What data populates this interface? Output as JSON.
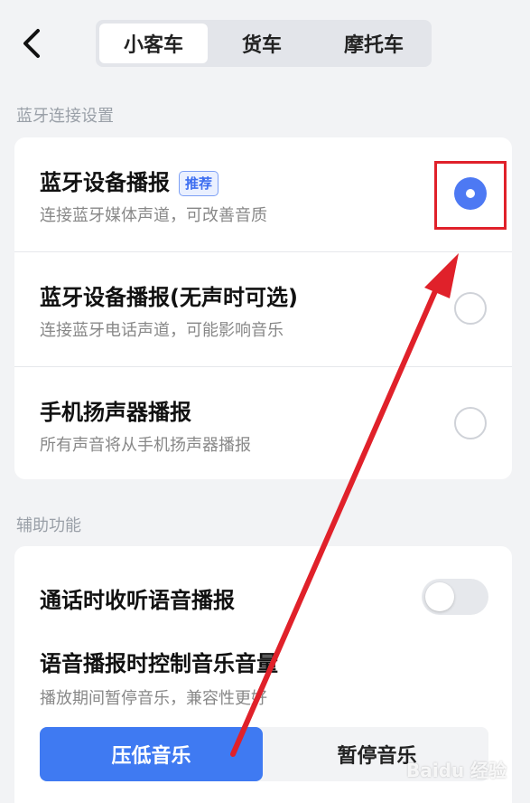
{
  "header": {
    "tabs": [
      {
        "label": "小客车",
        "active": true
      },
      {
        "label": "货车",
        "active": false
      },
      {
        "label": "摩托车",
        "active": false
      }
    ]
  },
  "bluetooth_section": {
    "title": "蓝牙连接设置",
    "options": [
      {
        "title": "蓝牙设备播报",
        "badge": "推荐",
        "subtitle": "连接蓝牙媒体声道，可改善音质",
        "selected": true
      },
      {
        "title": "蓝牙设备播报(无声时可选)",
        "subtitle": "连接蓝牙电话声道，可能影响音乐",
        "selected": false
      },
      {
        "title": "手机扬声器播报",
        "subtitle": "所有声音将从手机扬声器播报",
        "selected": false
      }
    ]
  },
  "assist_section": {
    "title": "辅助功能",
    "call_listen": {
      "title": "通话时收听语音播报",
      "enabled": false
    },
    "music_control": {
      "title": "语音播报时控制音乐音量",
      "subtitle": "播放期间暂停音乐，兼容性更好",
      "options": [
        "压低音乐",
        "暂停音乐"
      ],
      "selected": "压低音乐"
    }
  },
  "colors": {
    "accent": "#4d79f3",
    "highlight": "#e0212a"
  },
  "watermark": "Baidu 经验"
}
